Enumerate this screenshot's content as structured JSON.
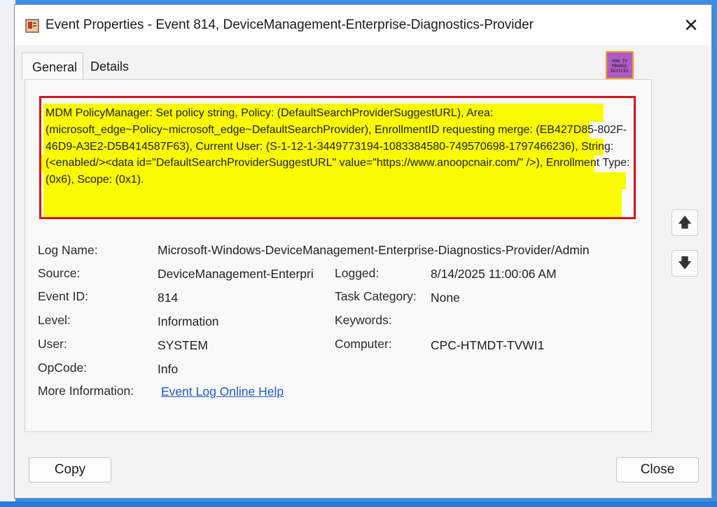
{
  "window": {
    "title": "Event Properties - Event 814, DeviceManagement-Enterprise-Diagnostics-Provider",
    "close_glyph": "✕"
  },
  "tabs": [
    {
      "label": "General",
      "selected": true
    },
    {
      "label": "Details",
      "selected": false
    }
  ],
  "description": "MDM PolicyManager: Set policy string, Policy: (DefaultSearchProviderSuggestURL), Area: (microsoft_edge~Policy~microsoft_edge~DefaultSearchProvider), EnrollmentID requesting merge: (EB427D85-802F-46D9-A3E2-D5B414587F63), Current User: (S-1-12-1-3449773194-1083384580-749570698-1797466236), String: (<enabled/><data id=\"DefaultSearchProviderSuggestURL\" value=\"https://www.anoopcnair.com/\" />), Enrollment Type: (0x6), Scope: (0x1).",
  "fields": {
    "log_name": {
      "label": "Log Name:",
      "value": "Microsoft-Windows-DeviceManagement-Enterprise-Diagnostics-Provider/Admin"
    },
    "source": {
      "label": "Source:",
      "value": "DeviceManagement-Enterpri"
    },
    "logged": {
      "label": "Logged:",
      "value": "8/14/2025 11:00:06 AM"
    },
    "event_id": {
      "label": "Event ID:",
      "value": "814"
    },
    "task_category": {
      "label": "Task Category:",
      "value": "None"
    },
    "level": {
      "label": "Level:",
      "value": "Information"
    },
    "keywords": {
      "label": "Keywords:",
      "value": ""
    },
    "user": {
      "label": "User:",
      "value": "SYSTEM"
    },
    "computer": {
      "label": "Computer:",
      "value": "CPC-HTMDT-TVWI1"
    },
    "opcode": {
      "label": "OpCode:",
      "value": "Info"
    },
    "more_info": {
      "label": "More Information:",
      "value": "Event Log Online Help"
    }
  },
  "buttons": {
    "copy": "Copy",
    "close": "Close",
    "up_glyph": "🡅",
    "down_glyph": "🡇"
  },
  "logo_text": "HOW TO MANAGE DEVICES",
  "colors": {
    "highlight": "#fafa00",
    "box_border": "#d0161d",
    "link": "#1f58c7",
    "background": "#3a8ee6"
  }
}
